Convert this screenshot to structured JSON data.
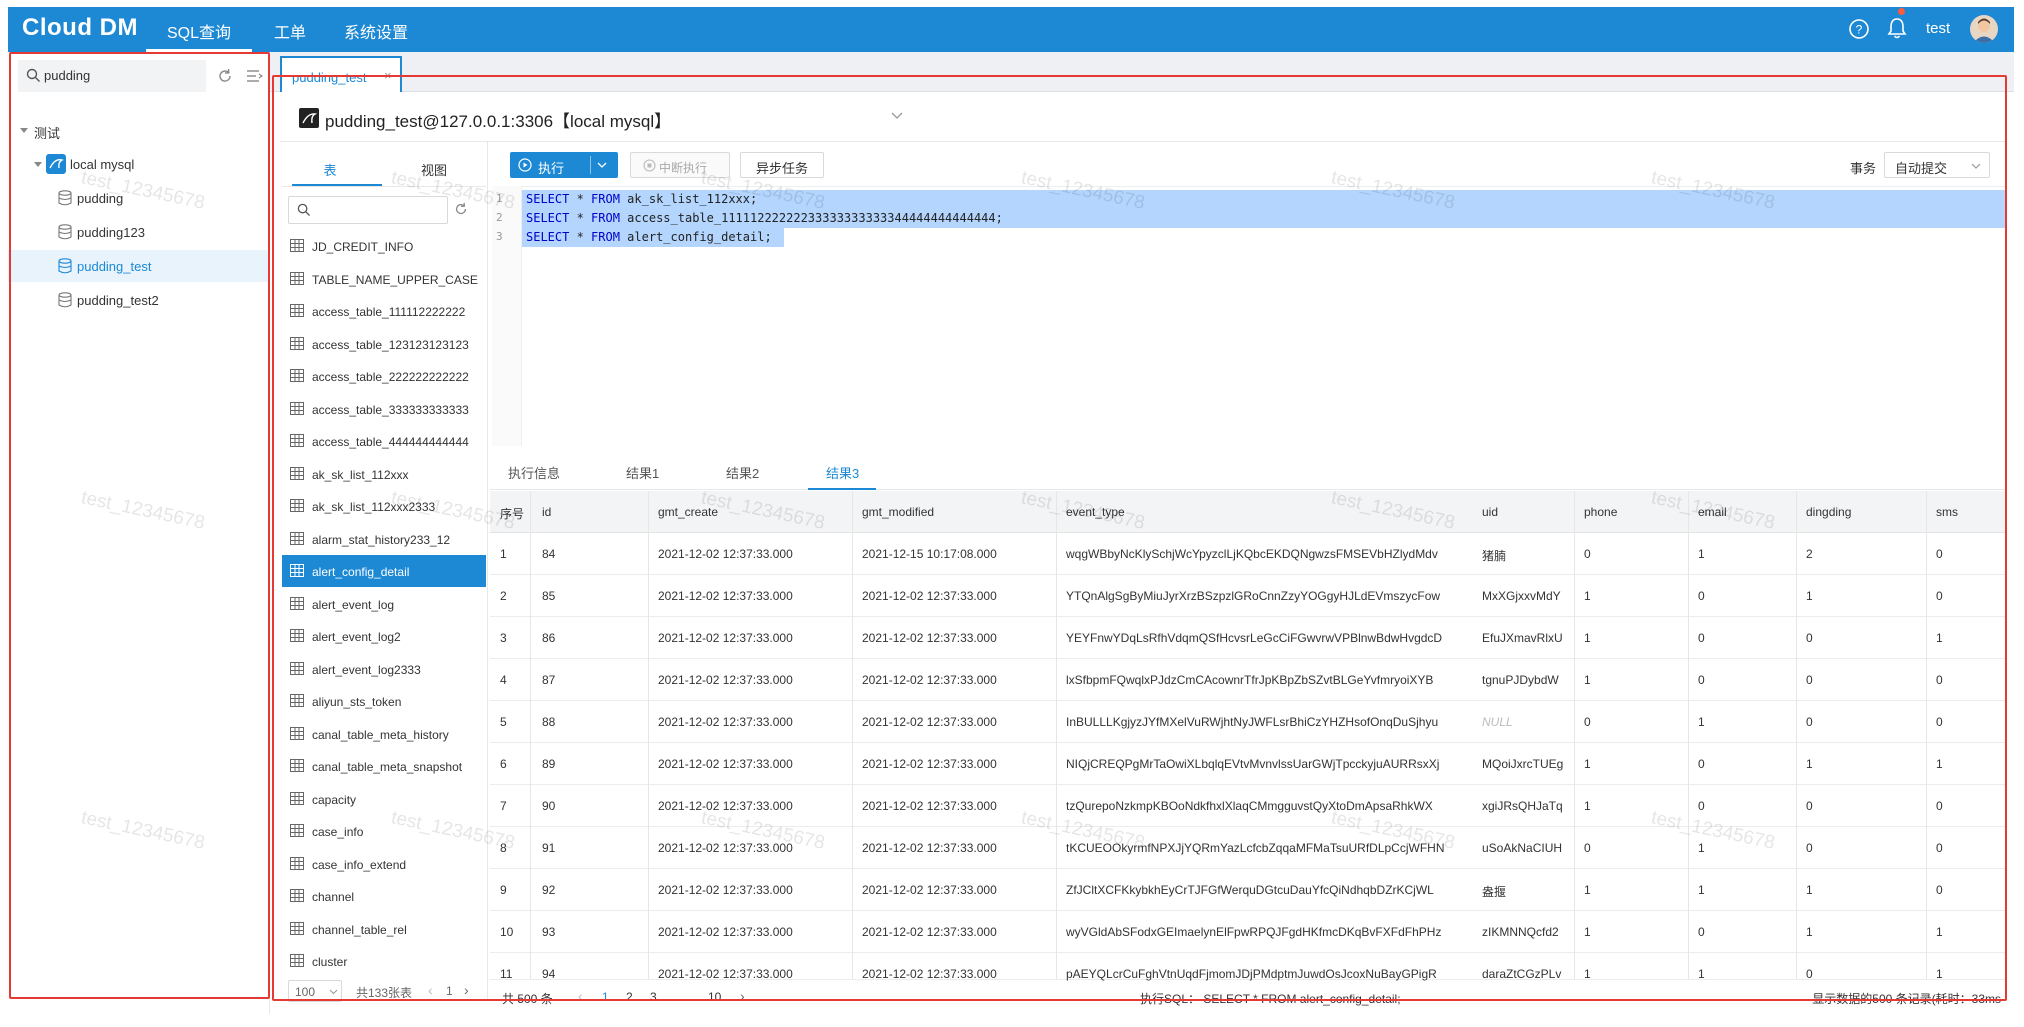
{
  "header": {
    "brand": "Cloud DM",
    "nav": [
      "SQL查询",
      "工单",
      "系统设置"
    ],
    "user": "test"
  },
  "sidebar": {
    "search_value": "pudding",
    "tree": {
      "group": "测试",
      "connection": "local mysql",
      "databases": [
        "pudding",
        "pudding123",
        "pudding_test",
        "pudding_test2"
      ],
      "selected": "pudding_test"
    }
  },
  "tab": {
    "label": "pudding_test"
  },
  "connection": {
    "label": "pudding_test@127.0.0.1:3306【local mysql】"
  },
  "table_panel": {
    "tabs": [
      "表",
      "视图"
    ],
    "items": [
      "JD_CREDIT_INFO",
      "TABLE_NAME_UPPER_CASE",
      "access_table_111112222222",
      "access_table_123123123123",
      "access_table_222222222222",
      "access_table_333333333333",
      "access_table_444444444444",
      "ak_sk_list_112xxx",
      "ak_sk_list_112xxx2333",
      "alarm_stat_history233_12",
      "alert_config_detail",
      "alert_event_log",
      "alert_event_log2",
      "alert_event_log2333",
      "aliyun_sts_token",
      "canal_table_meta_history",
      "canal_table_meta_snapshot",
      "capacity",
      "case_info",
      "case_info_extend",
      "channel",
      "channel_table_rel",
      "cluster"
    ],
    "selected": "alert_config_detail",
    "page_size": "100",
    "total": "共133张表",
    "page": "1"
  },
  "toolbar": {
    "exec": "执行",
    "stop": "中断执行",
    "async": "异步任务",
    "tx_label": "事务",
    "tx_mode": "自动提交"
  },
  "editor": {
    "lines": [
      "SELECT * FROM ak_sk_list_112xxx;",
      "SELECT * FROM access_table_11111222222233333333333344444444444444;",
      "SELECT * FROM alert_config_detail;"
    ]
  },
  "results": {
    "tabs": [
      "执行信息",
      "结果1",
      "结果2",
      "结果3"
    ],
    "active_tab": "结果3",
    "columns": [
      "序号",
      "id",
      "gmt_create",
      "gmt_modified",
      "event_type",
      "uid",
      "phone",
      "email",
      "dingding",
      "sms"
    ],
    "rows": [
      [
        "1",
        "84",
        "2021-12-02 12:37:33.000",
        "2021-12-15 10:17:08.000",
        "wqgWBbyNcKlySchjWcYpyzclLjKQbcEKDQNgwzsFMSEVbHZlydMdv",
        "猪腩",
        "0",
        "1",
        "2",
        "0"
      ],
      [
        "2",
        "85",
        "2021-12-02 12:37:33.000",
        "2021-12-02 12:37:33.000",
        "YTQnAlgSgByMiuJyrXrzBSzpzlGRoCnnZzyYOGgyHJLdEVmszycFow",
        "MxXGjxxvMdY",
        "1",
        "0",
        "1",
        "0"
      ],
      [
        "3",
        "86",
        "2021-12-02 12:37:33.000",
        "2021-12-02 12:37:33.000",
        "YEYFnwYDqLsRfhVdqmQSfHcvsrLeGcCiFGwvrwVPBlnwBdwHvgdcD",
        "EfuJXmavRlxU",
        "1",
        "0",
        "0",
        "1"
      ],
      [
        "4",
        "87",
        "2021-12-02 12:37:33.000",
        "2021-12-02 12:37:33.000",
        "lxSfbpmFQwqlxPJdzCmCAcownrTfrJpKBpZbSZvtBLGeYvfmryoiXYB",
        "tgnuPJDybdW",
        "1",
        "0",
        "0",
        "0"
      ],
      [
        "5",
        "88",
        "2021-12-02 12:37:33.000",
        "2021-12-02 12:37:33.000",
        "InBULLLKgjyzJYfMXelVuRWjhtNyJWFLsrBhiCzYHZHsofOnqDuSjhyu",
        "NULL",
        "0",
        "1",
        "0",
        "0"
      ],
      [
        "6",
        "89",
        "2021-12-02 12:37:33.000",
        "2021-12-02 12:37:33.000",
        "NIQjCREQPgMrTaOwiXLbqlqEVtvMvnvlssUarGWjTpcckyjuAURRsxXj",
        "MQoiJxrcTUEg",
        "1",
        "0",
        "1",
        "1"
      ],
      [
        "7",
        "90",
        "2021-12-02 12:37:33.000",
        "2021-12-02 12:37:33.000",
        "tzQurepoNzkmpKBOoNdkfhxlXlaqCMmgguvstQyXtoDmApsaRhkWX",
        "xgiJRsQHJaTq",
        "1",
        "0",
        "0",
        "0"
      ],
      [
        "8",
        "91",
        "2021-12-02 12:37:33.000",
        "2021-12-02 12:37:33.000",
        "tKCUEOOkyrmfNPXJjYQRmYazLcfcbZqqaMFMaTsuURfDLpCcjWFHN",
        "uSoAkNaCIUH",
        "0",
        "1",
        "0",
        "0"
      ],
      [
        "9",
        "92",
        "2021-12-02 12:37:33.000",
        "2021-12-02 12:37:33.000",
        "ZfJCltXCFKkybkhEyCrTJFGfWerquDGtcuDauYfcQiNdhqbDZrKCjWL",
        "盎揠",
        "1",
        "1",
        "1",
        "0"
      ],
      [
        "10",
        "93",
        "2021-12-02 12:37:33.000",
        "2021-12-02 12:37:33.000",
        "wyVGldAbSFodxGEImaelynElFpwRPQJFgdHKfmcDKqBvFXFdFhPHz",
        "zIKMNNQcfd2",
        "1",
        "0",
        "1",
        "1"
      ],
      [
        "11",
        "94",
        "2021-12-02 12:37:33.000",
        "2021-12-02 12:37:33.000",
        "pAEYQLcrCuFghVtnUqdFjmomJDjPMdptmJuwdOsJcoxNuBayGPigR",
        "daraZtCGzPLv",
        "1",
        "1",
        "0",
        "1"
      ]
    ],
    "footer": {
      "total": "共 500 条",
      "pages": [
        "1",
        "2",
        "3",
        "…",
        "10"
      ],
      "current_page": "1",
      "exec_sql": "执行SQL：  SELECT * FROM alert_config_detail;",
      "summary": "显示数据的500 条记录(耗时：33ms"
    }
  },
  "watermark": "test_12345678",
  "colors": {
    "primary": "#1d89d4",
    "highlight_box": "#e53935",
    "selection": "#b4d5fe"
  }
}
